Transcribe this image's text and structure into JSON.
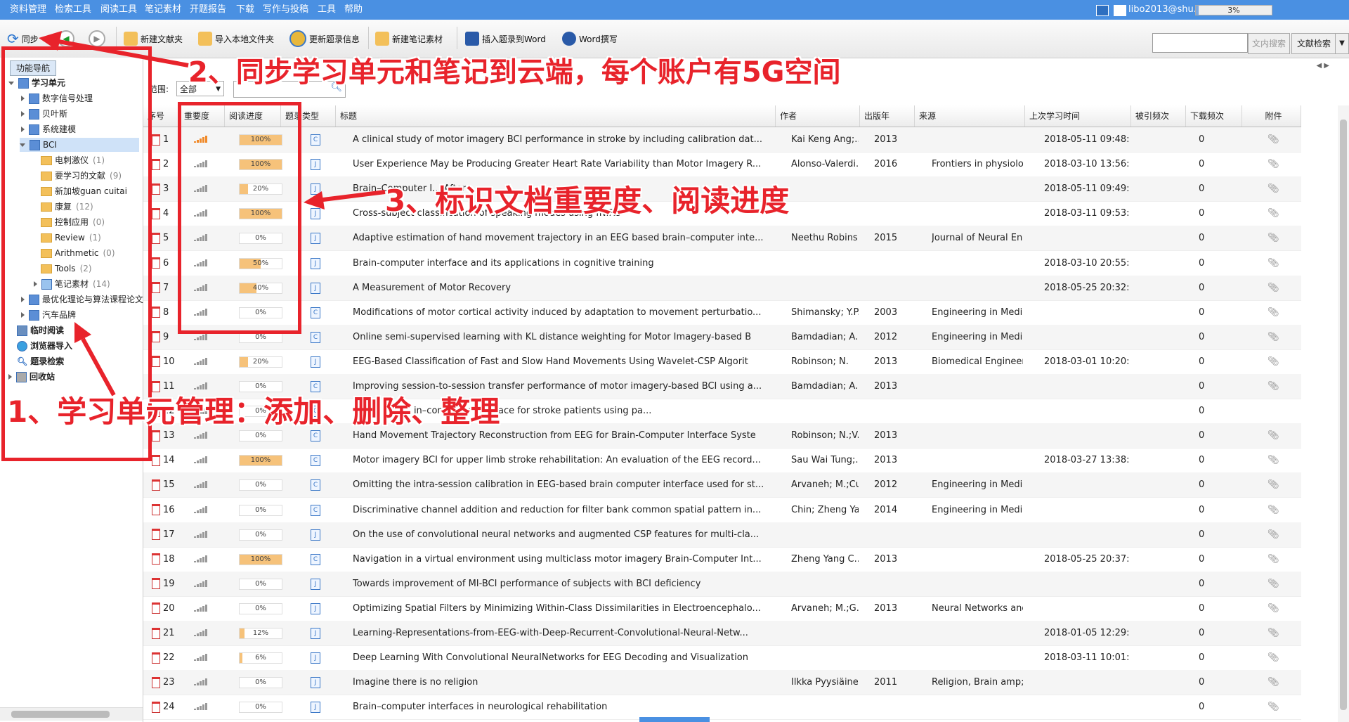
{
  "menu": {
    "items": [
      "资料管理",
      "检索工具",
      "阅读工具",
      "笔记素材",
      "开题报告",
      "下载",
      "写作与投稿",
      "工具",
      "帮助"
    ],
    "user": "libo2013@shu.ed...",
    "progress": "3%"
  },
  "toolbar": {
    "sync": "同步",
    "new_folder": "新建文献夹",
    "import_local": "导入本地文件夹",
    "update_meta": "更新题录信息",
    "new_note": "新建笔记素材",
    "insert_word": "插入题录到Word",
    "word_write": "Word撰写",
    "search_in": "文内搜索",
    "lit_search": "文献检索"
  },
  "sidebar": {
    "tab": "功能导航",
    "items": [
      {
        "label": "学习单元",
        "count": ""
      },
      {
        "label": "数字信号处理",
        "count": ""
      },
      {
        "label": "贝叶斯",
        "count": ""
      },
      {
        "label": "系统建模",
        "count": ""
      },
      {
        "label": "BCI",
        "count": ""
      },
      {
        "label": "电刺激仪",
        "count": "(1)"
      },
      {
        "label": "要学习的文献",
        "count": "(9)"
      },
      {
        "label": "新加坡guan cuitai",
        "count": ""
      },
      {
        "label": "康复",
        "count": "(12)"
      },
      {
        "label": "控制应用",
        "count": "(0)"
      },
      {
        "label": "Review",
        "count": "(1)"
      },
      {
        "label": "Arithmetic",
        "count": "(0)"
      },
      {
        "label": "Tools",
        "count": "(2)"
      },
      {
        "label": "笔记素材",
        "count": "(14)"
      },
      {
        "label": "最优化理论与算法课程论文",
        "count": ""
      },
      {
        "label": "汽车品牌",
        "count": ""
      },
      {
        "label": "临时阅读",
        "count": ""
      },
      {
        "label": "浏览器导入",
        "count": ""
      },
      {
        "label": "题录检索",
        "count": ""
      },
      {
        "label": "回收站",
        "count": ""
      }
    ]
  },
  "scope": {
    "label": "范围:",
    "value": "全部"
  },
  "table": {
    "headers": [
      "序号",
      "重要度",
      "阅读进度",
      "题录类型",
      "标题",
      "作者",
      "出版年",
      "来源",
      "上次学习时间",
      "被引频次",
      "下载频次",
      "附件"
    ],
    "rows": [
      {
        "n": "1",
        "imp": 5,
        "prog": 100,
        "type": "C",
        "title": "A clinical study of motor imagery BCI performance in stroke by including calibration dat...",
        "author": "Kai Keng Ang;...",
        "year": "2013",
        "source": "",
        "last": "2018-05-11 09:48:",
        "cited": "",
        "dl": "0",
        "att": true
      },
      {
        "n": "2",
        "imp": 0,
        "prog": 100,
        "type": "J",
        "title": "User Experience May be Producing Greater Heart Rate Variability than Motor Imagery R...",
        "author": "Alonso-Valerdi...",
        "year": "2016",
        "source": "Frontiers in physiology",
        "last": "2018-03-10 13:56:",
        "cited": "",
        "dl": "0",
        "att": true
      },
      {
        "n": "3",
        "imp": 0,
        "prog": 20,
        "type": "J",
        "title": "Brain–Computer I... After",
        "author": "",
        "year": "",
        "source": "",
        "last": "2018-05-11 09:49:",
        "cited": "",
        "dl": "0",
        "att": true
      },
      {
        "n": "4",
        "imp": 0,
        "prog": 100,
        "type": "J",
        "title": "Cross-subject classification of speaking modes using fNIRS",
        "author": "",
        "year": "",
        "source": "",
        "last": "2018-03-11 09:53:",
        "cited": "",
        "dl": "0",
        "att": true
      },
      {
        "n": "5",
        "imp": 0,
        "prog": 0,
        "type": "J",
        "title": "Adaptive estimation of hand movement trajectory in an EEG based brain–computer inte...",
        "author": "Neethu Robins...",
        "year": "2015",
        "source": "Journal of Neural Eng...",
        "last": "",
        "cited": "",
        "dl": "0",
        "att": true
      },
      {
        "n": "6",
        "imp": 0,
        "prog": 50,
        "type": "J",
        "title": "Brain-computer interface and its applications in cognitive training",
        "author": "",
        "year": "",
        "source": "",
        "last": "2018-03-10 20:55:",
        "cited": "",
        "dl": "0",
        "att": true
      },
      {
        "n": "7",
        "imp": 0,
        "prog": 40,
        "type": "J",
        "title": "A Measurement of Motor Recovery",
        "author": "",
        "year": "",
        "source": "",
        "last": "2018-05-25 20:32:",
        "cited": "",
        "dl": "0",
        "att": true
      },
      {
        "n": "8",
        "imp": 0,
        "prog": 0,
        "type": "C",
        "title": "Modifications of motor cortical activity induced by adaptation to movement perturbatio...",
        "author": "Shimansky; Y.P...",
        "year": "2003",
        "source": "Engineering in Medici...",
        "last": "",
        "cited": "",
        "dl": "0",
        "att": true
      },
      {
        "n": "9",
        "imp": 0,
        "prog": 0,
        "type": "C",
        "title": "Online semi-supervised learning with KL distance weighting for Motor Imagery-based B",
        "author": "Bamdadian; A.;...",
        "year": "2012",
        "source": "Engineering in Medici...",
        "last": "",
        "cited": "",
        "dl": "0",
        "att": true
      },
      {
        "n": "10",
        "imp": 0,
        "prog": 20,
        "type": "J",
        "title": "EEG-Based Classification of Fast and Slow Hand Movements Using Wavelet-CSP Algorit",
        "author": "Robinson; N.",
        "year": "2013",
        "source": "Biomedical Engineeri...",
        "last": "2018-03-01 10:20:",
        "cited": "",
        "dl": "0",
        "att": true
      },
      {
        "n": "11",
        "imp": 0,
        "prog": 0,
        "type": "C",
        "title": "Improving session-to-session transfer performance of motor imagery-based BCI using a...",
        "author": "Bamdadian; A.;...",
        "year": "2013",
        "source": "",
        "last": "",
        "cited": "",
        "dl": "0",
        "att": true
      },
      {
        "n": "12",
        "imp": 0,
        "prog": 0,
        "type": "C",
        "title": "Fac... imag... in–computer interface for stroke patients using pa...",
        "author": "",
        "year": "",
        "source": "",
        "last": "",
        "cited": "",
        "dl": "0",
        "att": false
      },
      {
        "n": "13",
        "imp": 0,
        "prog": 0,
        "type": "C",
        "title": "Hand Movement Trajectory Reconstruction from EEG for Brain-Computer Interface Syste",
        "author": "Robinson; N.;V...",
        "year": "2013",
        "source": "",
        "last": "",
        "cited": "",
        "dl": "0",
        "att": true
      },
      {
        "n": "14",
        "imp": 0,
        "prog": 100,
        "type": "C",
        "title": "Motor imagery BCI for upper limb stroke rehabilitation: An evaluation of the EEG record...",
        "author": "Sau Wai Tung;...",
        "year": "2013",
        "source": "",
        "last": "2018-03-27 13:38:",
        "cited": "",
        "dl": "0",
        "att": true
      },
      {
        "n": "15",
        "imp": 0,
        "prog": 0,
        "type": "C",
        "title": "Omitting the intra-session calibration in EEG-based brain computer interface used for st...",
        "author": "Arvaneh; M.;Cu...",
        "year": "2012",
        "source": "Engineering in Medici...",
        "last": "",
        "cited": "",
        "dl": "0",
        "att": true
      },
      {
        "n": "16",
        "imp": 0,
        "prog": 0,
        "type": "C",
        "title": "Discriminative channel addition and reduction for filter bank common spatial pattern in...",
        "author": "Chin; Zheng Ya...",
        "year": "2014",
        "source": "Engineering in Medici...",
        "last": "",
        "cited": "",
        "dl": "0",
        "att": true
      },
      {
        "n": "17",
        "imp": 0,
        "prog": 0,
        "type": "J",
        "title": "On the use of convolutional neural networks and augmented CSP features for multi-cla...",
        "author": "",
        "year": "",
        "source": "",
        "last": "",
        "cited": "",
        "dl": "0",
        "att": true
      },
      {
        "n": "18",
        "imp": 0,
        "prog": 100,
        "type": "C",
        "title": "Navigation in a virtual environment using multiclass motor imagery Brain-Computer Int...",
        "author": "Zheng Yang C...",
        "year": "2013",
        "source": "",
        "last": "2018-05-25 20:37:",
        "cited": "",
        "dl": "0",
        "att": true
      },
      {
        "n": "19",
        "imp": 0,
        "prog": 0,
        "type": "J",
        "title": "Towards improvement of MI-BCI performance of subjects with BCI deficiency",
        "author": "",
        "year": "",
        "source": "",
        "last": "",
        "cited": "",
        "dl": "0",
        "att": true
      },
      {
        "n": "20",
        "imp": 0,
        "prog": 0,
        "type": "J",
        "title": "Optimizing Spatial Filters by Minimizing Within-Class Dissimilarities in Electroencephalo...",
        "author": "Arvaneh; M.;G...",
        "year": "2013",
        "source": "Neural Networks and...",
        "last": "",
        "cited": "",
        "dl": "0",
        "att": true
      },
      {
        "n": "21",
        "imp": 0,
        "prog": 12,
        "type": "J",
        "title": "Learning-Representations-from-EEG-with-Deep-Recurrent-Convolutional-Neural-Netw...",
        "author": "",
        "year": "",
        "source": "",
        "last": "2018-01-05 12:29:",
        "cited": "",
        "dl": "0",
        "att": true
      },
      {
        "n": "22",
        "imp": 0,
        "prog": 6,
        "type": "J",
        "title": "Deep Learning With Convolutional NeuralNetworks for EEG Decoding and Visualization",
        "author": "",
        "year": "",
        "source": "",
        "last": "2018-03-11 10:01:",
        "cited": "",
        "dl": "0",
        "att": true
      },
      {
        "n": "23",
        "imp": 0,
        "prog": 0,
        "type": "J",
        "title": "Imagine there is no religion",
        "author": "Ilkka Pyysiäinen",
        "year": "2011",
        "source": "Religion, Brain amp; ...",
        "last": "",
        "cited": "",
        "dl": "0",
        "att": true
      },
      {
        "n": "24",
        "imp": 0,
        "prog": 0,
        "type": "J",
        "title": "Brain–computer interfaces in neurological rehabilitation",
        "author": "",
        "year": "",
        "source": "",
        "last": "",
        "cited": "",
        "dl": "0",
        "att": true
      }
    ]
  },
  "annotations": {
    "a1": "1、学习单元管理：添加、删除、整理",
    "a2": "2、同步学习单元和笔记到云端，每个账户有5G空间",
    "a3": "3、标识文档重要度、阅读进度"
  },
  "colors": {
    "menubar": "#4a90e2",
    "annotation": "#e8232b",
    "progress_fill": "#f6c27a"
  }
}
